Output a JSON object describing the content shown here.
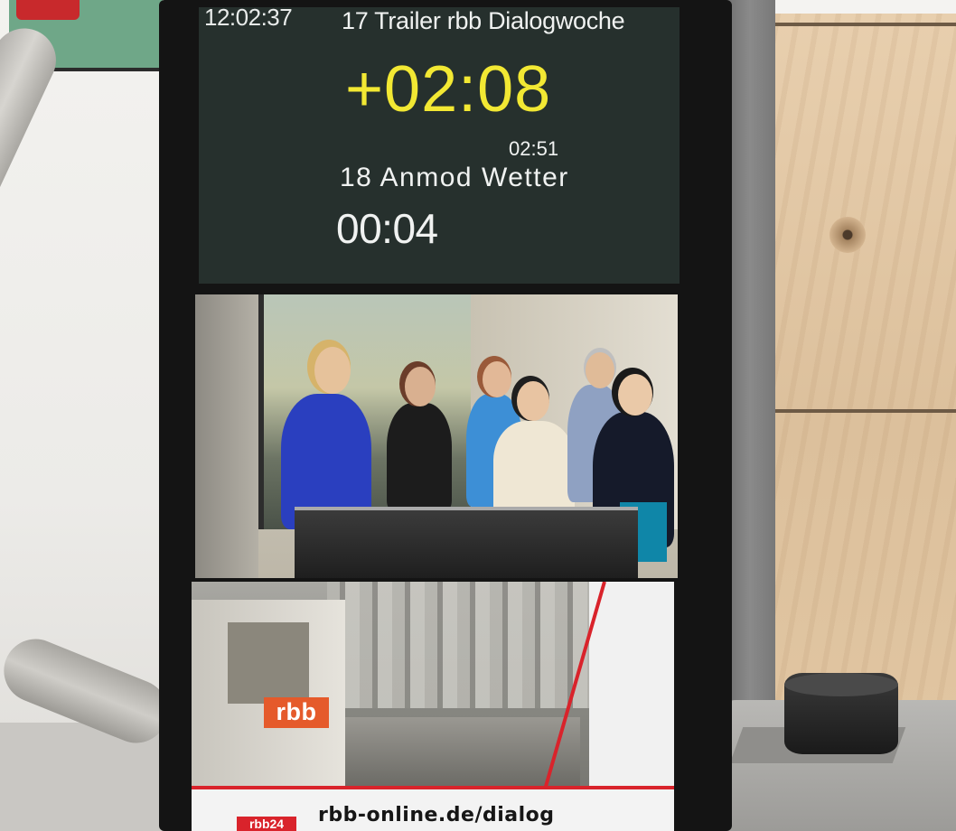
{
  "rundown": {
    "clock": "12:02:37",
    "current_item": "17 Trailer rbb Dialogwoche",
    "countdown": "+02:08",
    "next_duration": "02:51",
    "next_item": "18 Anmod Wetter",
    "elapsed": "00:04"
  },
  "location_graphic": {
    "logo": "rbb",
    "url": "rbb-online.de/dialog",
    "badge": "rbb24"
  },
  "colors": {
    "countdown": "#f2e833",
    "panel": "#26302d",
    "brand_orange": "#e55a2b",
    "brand_red": "#d9232b"
  }
}
